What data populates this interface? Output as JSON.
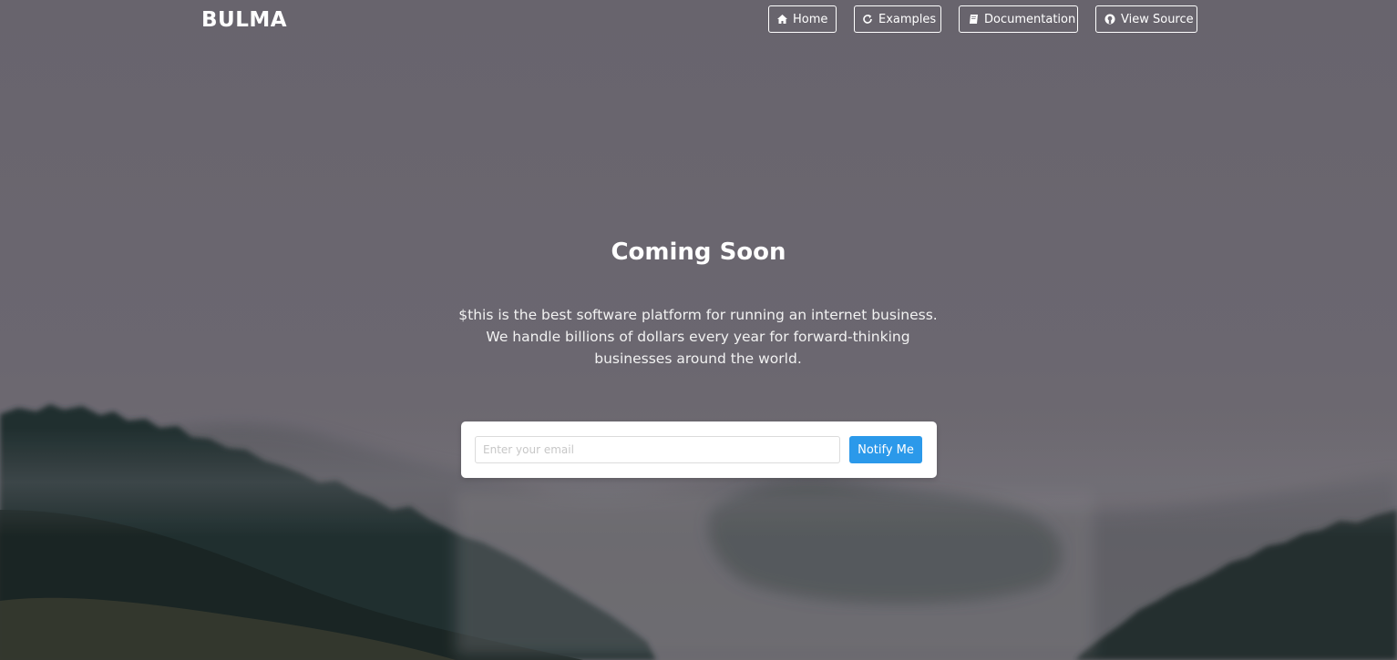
{
  "brand": {
    "name": "BULMA"
  },
  "nav": {
    "items": [
      {
        "label": "Home",
        "icon": "home-icon"
      },
      {
        "label": "Examples",
        "icon": "refresh-icon"
      },
      {
        "label": "Documentation",
        "icon": "book-icon"
      },
      {
        "label": "View Source",
        "icon": "github-icon"
      }
    ]
  },
  "hero": {
    "title": "Coming Soon",
    "subtitle_lines": [
      "$this is the best software platform for running an internet business.",
      "We handle billions of dollars every year for forward-thinking",
      "businesses around the world."
    ]
  },
  "signup": {
    "email_placeholder": "Enter your email",
    "email_value": "",
    "button_label": "Notify Me"
  },
  "colors": {
    "sky": "#6f6b74",
    "accent": "#2b99ea",
    "forest": "#1f2a28"
  }
}
